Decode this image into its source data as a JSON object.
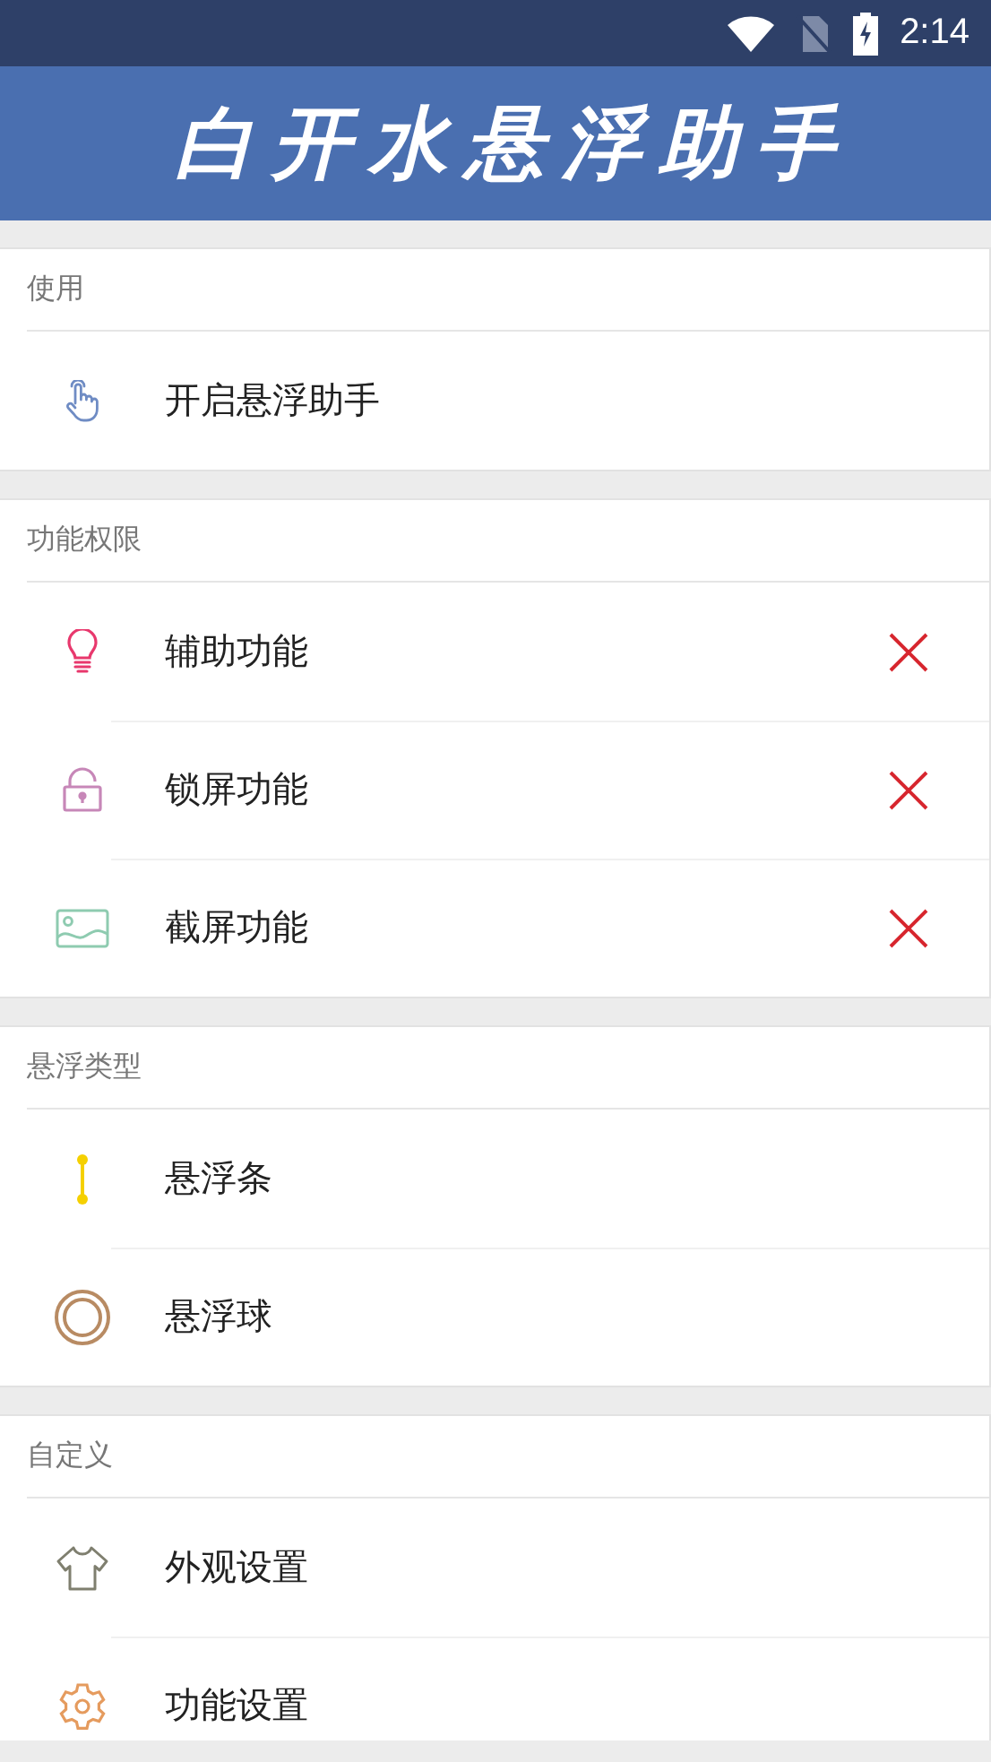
{
  "status_bar": {
    "time": "2:14"
  },
  "app_bar": {
    "title": "白开水悬浮助手"
  },
  "sections": [
    {
      "title": "使用",
      "items": [
        {
          "kind": "tap",
          "label": "开启悬浮助手"
        }
      ]
    },
    {
      "title": "功能权限",
      "items": [
        {
          "kind": "bulb",
          "label": "辅助功能",
          "granted": false
        },
        {
          "kind": "lock",
          "label": "锁屏功能",
          "granted": false
        },
        {
          "kind": "image",
          "label": "截屏功能",
          "granted": false
        }
      ]
    },
    {
      "title": "悬浮类型",
      "items": [
        {
          "kind": "bar",
          "label": "悬浮条"
        },
        {
          "kind": "ball",
          "label": "悬浮球"
        }
      ]
    },
    {
      "title": "自定义",
      "items": [
        {
          "kind": "shirt",
          "label": "外观设置"
        },
        {
          "kind": "gear",
          "label": "功能设置"
        }
      ]
    }
  ]
}
